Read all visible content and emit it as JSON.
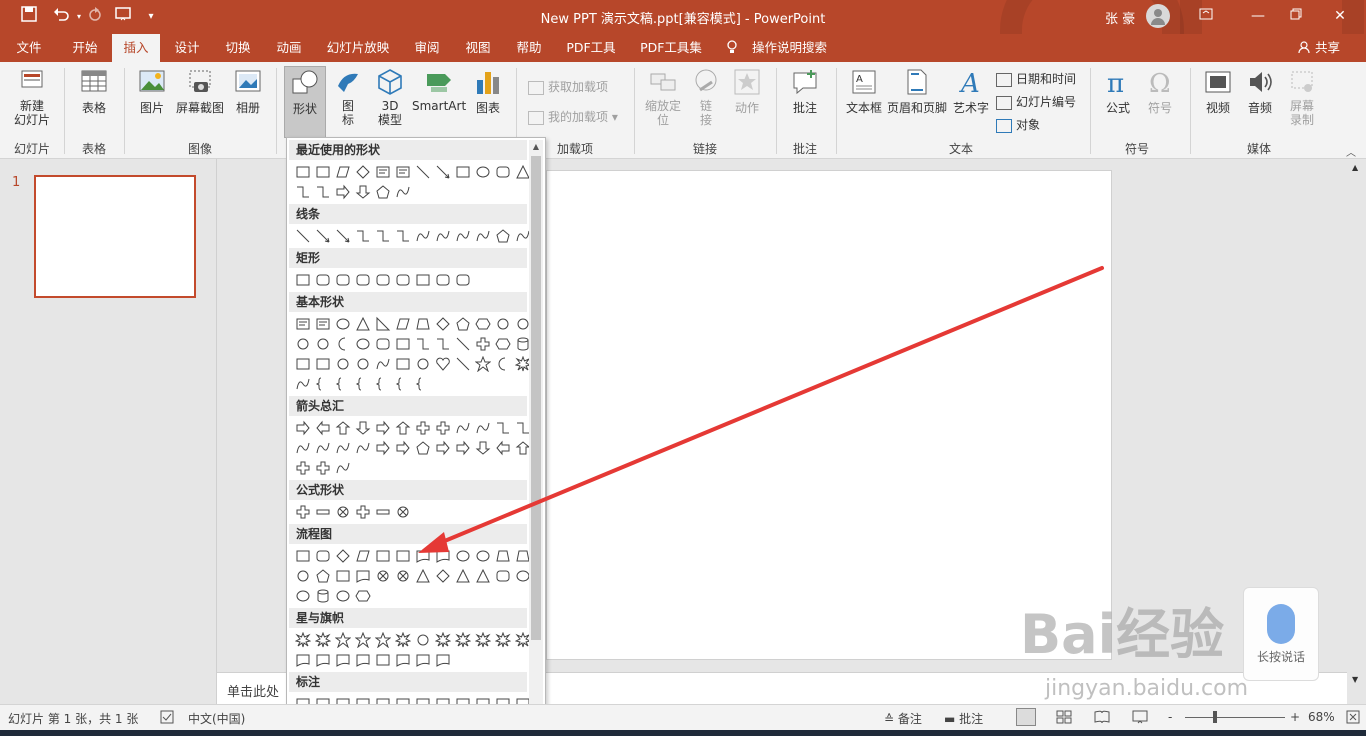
{
  "window": {
    "title": "New PPT 演示文稿.ppt[兼容模式]  -  PowerPoint",
    "user": "张 豪"
  },
  "quick_access": {
    "save_icon": "save-icon",
    "undo_icon": "undo-icon",
    "redo_icon": "redo-icon",
    "present_icon": "start-from-beginning-icon"
  },
  "tabs": [
    {
      "label": "文件"
    },
    {
      "label": "开始"
    },
    {
      "label": "插入"
    },
    {
      "label": "设计"
    },
    {
      "label": "切换"
    },
    {
      "label": "动画"
    },
    {
      "label": "幻灯片放映"
    },
    {
      "label": "审阅"
    },
    {
      "label": "视图"
    },
    {
      "label": "帮助"
    },
    {
      "label": "PDF工具"
    },
    {
      "label": "PDF工具集"
    }
  ],
  "tell_me": "操作说明搜索",
  "share": "共享",
  "ribbon": {
    "new_slide": "新建\n幻灯片",
    "table": "表格",
    "picture": "图片",
    "screenshot": "屏幕截图",
    "album": "相册",
    "shapes": "形状",
    "icons": "图\n标",
    "model3d": "3D\n模型",
    "smartart": "SmartArt",
    "chart": "图表",
    "get_addins": "获取加载项",
    "my_addins": "我的加载项",
    "zoom": "缩放定\n位",
    "link": "链\n接",
    "action": "动作",
    "comment": "批注",
    "textbox": "文本框",
    "header_footer": "页眉和页脚",
    "wordart": "艺术字",
    "datetime": "日期和时间",
    "slide_number": "幻灯片编号",
    "object": "对象",
    "equation": "公式",
    "symbol": "符号",
    "video": "视频",
    "audio": "音频",
    "screen_record": "屏幕\n录制",
    "groups": {
      "slides": "幻灯片",
      "tables": "表格",
      "images": "图像",
      "addins": "加载项",
      "links": "链接",
      "comments": "批注",
      "text": "文本",
      "symbols": "符号",
      "media": "媒体"
    }
  },
  "gallery": {
    "categories": [
      "最近使用的形状",
      "线条",
      "矩形",
      "基本形状",
      "箭头总汇",
      "公式形状",
      "流程图",
      "星与旗帜",
      "标注"
    ]
  },
  "thumbnails": [
    {
      "number": "1"
    }
  ],
  "notes_placeholder": "单击此处",
  "status": {
    "slide_info": "幻灯片 第 1 张，共 1 张",
    "language": "中文(中国)",
    "notes": "备注",
    "comments": "批注",
    "zoom": "68%"
  },
  "voice_widget": {
    "label": "长按说话"
  },
  "watermark": {
    "text": "Bai经验",
    "url": "jingyan.baidu.com"
  },
  "colors": {
    "accent": "#b7472a",
    "ribbon_bg": "#f3f3f3",
    "annotation_arrow": "#e53935"
  }
}
